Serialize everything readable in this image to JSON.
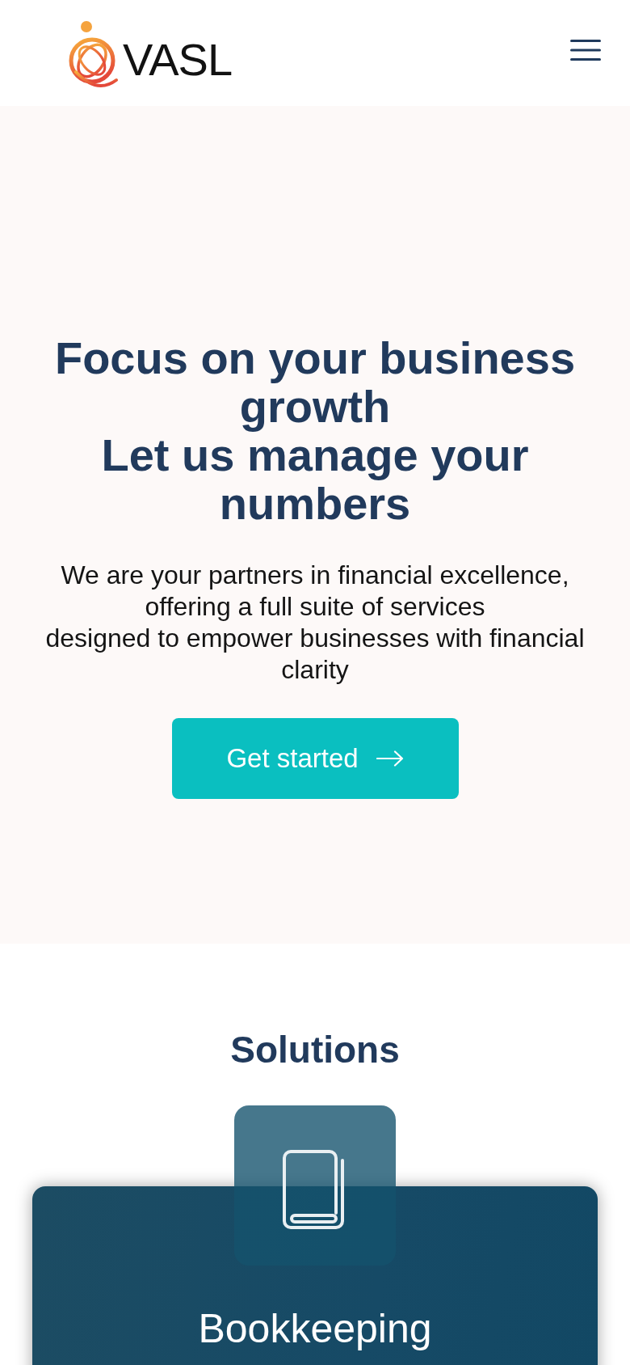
{
  "header": {
    "logo": {
      "name": "VASL"
    }
  },
  "hero": {
    "heading": "Focus on your business growth\nLet us manage your numbers",
    "paragraph": "We are your partners in financial excellence, offering a full suite of services\ndesigned to empower businesses with financial clarity",
    "button": {
      "label": "Get started"
    }
  },
  "solutions": {
    "title": "Solutions",
    "cards": [
      {
        "title": "Bookkeeping"
      }
    ]
  }
}
